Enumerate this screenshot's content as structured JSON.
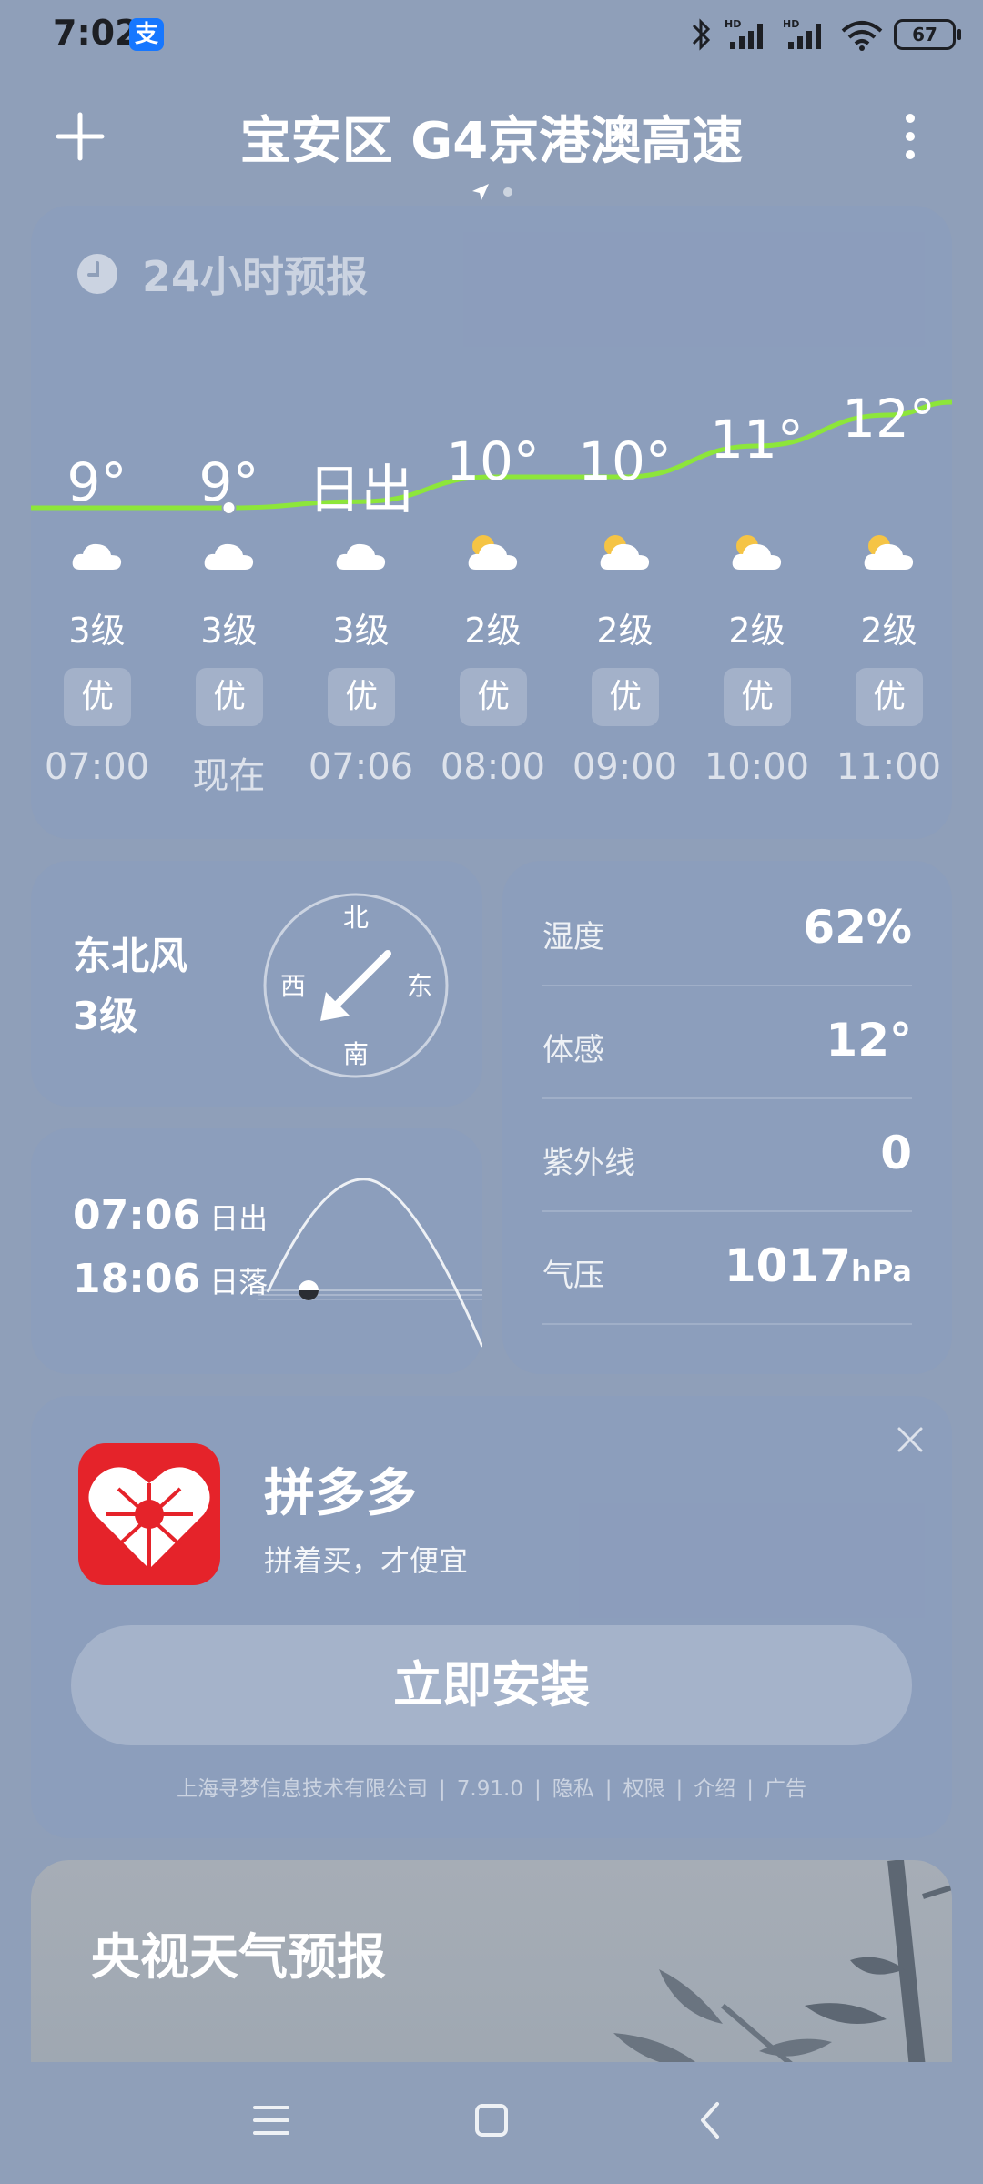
{
  "status_bar": {
    "time": "7:02",
    "alipay_badge": "支",
    "battery": "67",
    "signal_label": "HD"
  },
  "header": {
    "location_title": "宝安区 G4京港澳高速",
    "plus_icon": "plus-icon",
    "more_icon": "more-vertical-icon"
  },
  "forecast": {
    "title": "24小时预报",
    "hours": [
      {
        "temp": "9°",
        "icon": "cloudy",
        "wind": "3级",
        "aqi": "优",
        "time": "07:00"
      },
      {
        "temp": "9°",
        "icon": "cloudy",
        "wind": "3级",
        "aqi": "优",
        "time": "现在"
      },
      {
        "temp": "日出",
        "icon": "cloudy",
        "wind": "3级",
        "aqi": "优",
        "time": "07:06"
      },
      {
        "temp": "10°",
        "icon": "partly-sunny",
        "wind": "2级",
        "aqi": "优",
        "time": "08:00"
      },
      {
        "temp": "10°",
        "icon": "partly-sunny",
        "wind": "2级",
        "aqi": "优",
        "time": "09:00"
      },
      {
        "temp": "11°",
        "icon": "partly-sunny",
        "wind": "2级",
        "aqi": "优",
        "time": "10:00"
      },
      {
        "temp": "12°",
        "icon": "partly-sunny",
        "wind": "2级",
        "aqi": "优",
        "time": "11:00"
      }
    ],
    "temps_numeric": [
      9,
      9,
      9.2,
      10,
      10,
      11,
      12
    ]
  },
  "wind": {
    "direction": "东北风",
    "level": "3级",
    "compass": {
      "n": "北",
      "s": "南",
      "e": "东",
      "w": "西"
    }
  },
  "sun": {
    "sunrise_time": "07:06",
    "sunrise_label": "日出",
    "sunset_time": "18:06",
    "sunset_label": "日落"
  },
  "stats": {
    "humidity_label": "湿度",
    "humidity_value": "62%",
    "feels_label": "体感",
    "feels_value": "12°",
    "uv_label": "紫外线",
    "uv_value": "0",
    "pressure_label": "气压",
    "pressure_value": "1017",
    "pressure_unit": "hPa"
  },
  "ad": {
    "app_name": "拼多多",
    "slogan": "拼着买，才便宜",
    "install_label": "立即安装",
    "meta": [
      "上海寻梦信息技术有限公司",
      "|",
      "7.91.0",
      "|",
      "隐私",
      "|",
      "权限",
      "|",
      "介绍",
      "|",
      "广告"
    ]
  },
  "cctv": {
    "title": "央视天气预报"
  },
  "colors": {
    "background": "#8f9fb9",
    "curve": "#8de63a",
    "ad_logo": "#e5232a"
  }
}
